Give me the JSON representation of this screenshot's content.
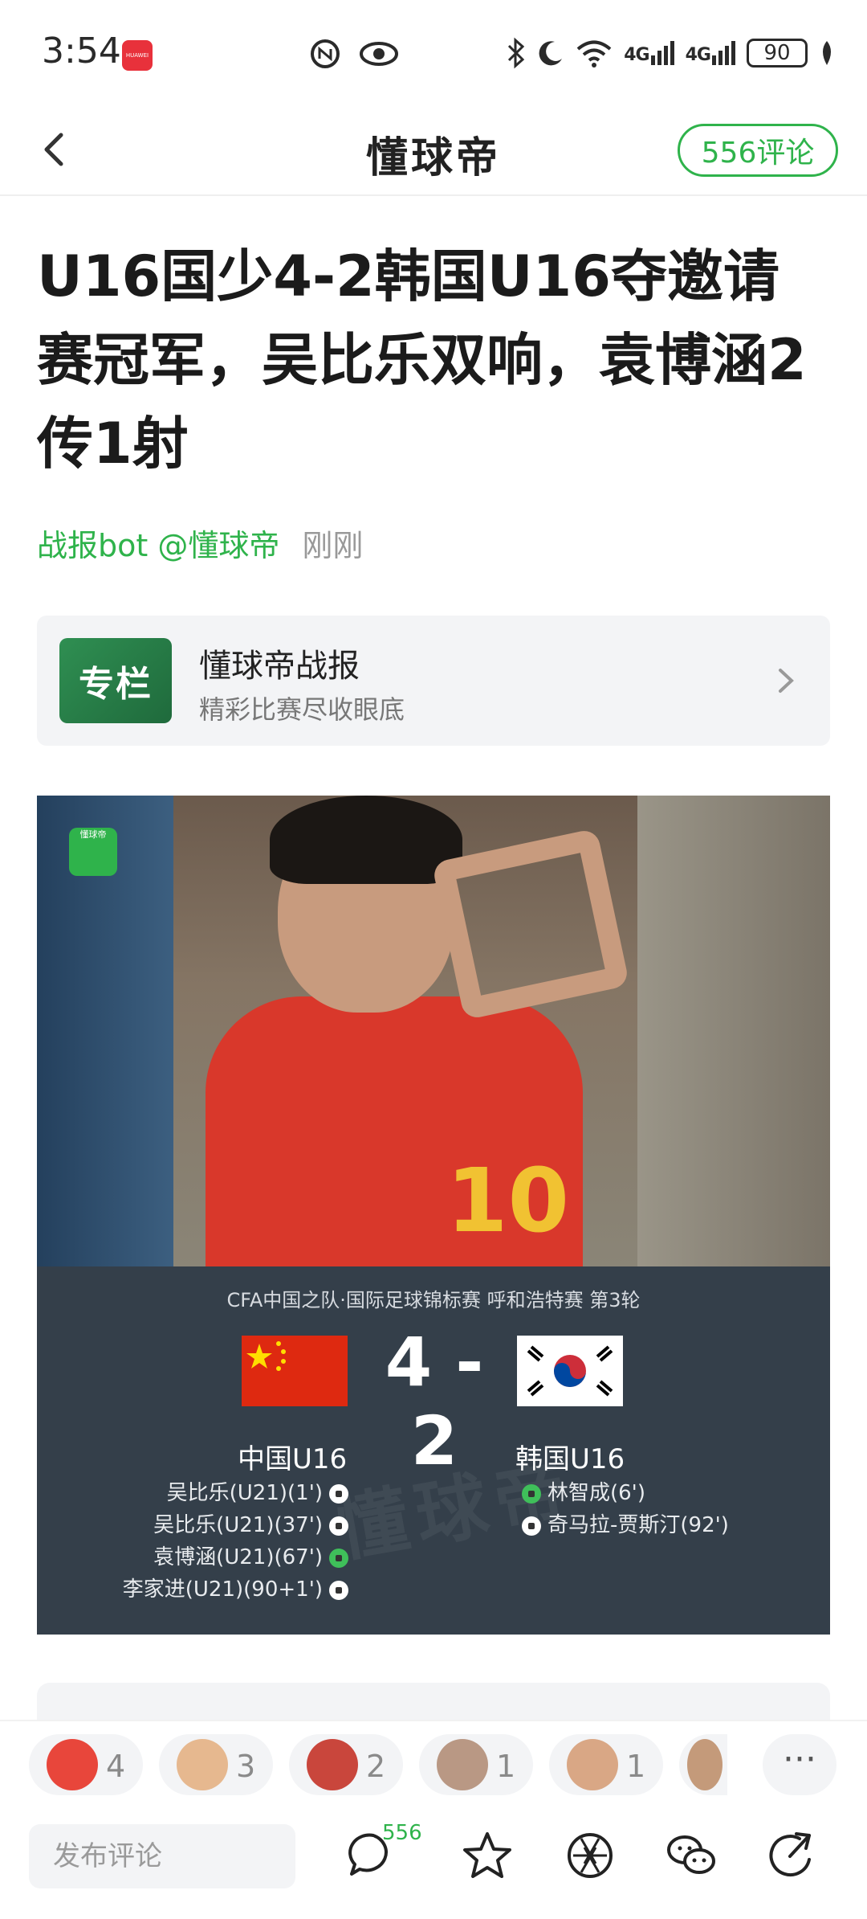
{
  "status_bar": {
    "time": "3:54",
    "app_badge": "HUAWEI",
    "battery": "90",
    "network": [
      "4G",
      "4G"
    ]
  },
  "nav": {
    "title": "懂球帝",
    "comment_count_label": "556评论"
  },
  "article": {
    "title": "U16国少4-2韩国U16夺邀请赛冠军，吴比乐双响，袁博涵2传1射",
    "author": "战报bot @懂球帝",
    "time": "刚刚"
  },
  "column": {
    "thumb_label": "专栏",
    "title": "懂球帝战报",
    "subtitle": "精彩比赛尽收眼底"
  },
  "image": {
    "logo_text": "懂球帝",
    "shirt_number": "10",
    "watermark": "懂球帝",
    "match_info": "CFA中国之队·国际足球锦标赛 呼和浩特赛 第3轮",
    "score": "4 - 2",
    "home_team": "中国U16",
    "away_team": "韩国U16",
    "home_scorers": [
      "吴比乐(U21)(1')",
      "吴比乐(U21)(37')",
      "袁博涵(U21)(67')",
      "李家进(U21)(90+1')"
    ],
    "away_scorers": [
      "林智成(6')",
      "奇马拉-贾斯汀(92')"
    ]
  },
  "reactions": {
    "counts": [
      "4",
      "3",
      "2",
      "1",
      "1"
    ],
    "more": "···"
  },
  "toolbar": {
    "comment_placeholder": "发布评论",
    "comment_badge": "556"
  },
  "colors": {
    "accent": "#2fb34b",
    "scoreboard_bg": "#343f4a"
  }
}
